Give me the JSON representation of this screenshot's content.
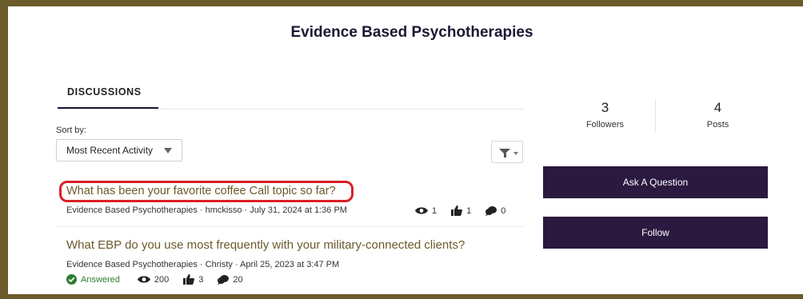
{
  "page": {
    "title": "Evidence Based Psychotherapies"
  },
  "tabs": [
    {
      "label": "DISCUSSIONS",
      "active": true
    }
  ],
  "sort": {
    "label": "Sort by:",
    "selected": "Most Recent Activity"
  },
  "discussions": [
    {
      "title": "What has been your favorite coffee Call topic so far?",
      "meta": "Evidence Based Psychotherapies · hmckisso · July 31, 2024 at 1:36 PM",
      "views": "1",
      "likes": "1",
      "replies": "0",
      "highlighted": true
    },
    {
      "title": "What EBP do you use most frequently with your military-connected clients?",
      "meta": "Evidence Based Psychotherapies · Christy · April 25, 2023 at 3:47 PM",
      "status": "Answered",
      "views": "200",
      "likes": "3",
      "replies": "20"
    }
  ],
  "sidebar": {
    "followers": {
      "count": "3",
      "label": "Followers"
    },
    "posts": {
      "count": "4",
      "label": "Posts"
    },
    "ask_button": "Ask A Question",
    "follow_button": "Follow"
  },
  "colors": {
    "frame": "#6b5a2a",
    "button_bg": "#2b1940",
    "title_link": "#6b5a2a",
    "highlight": "#d91f26",
    "answered": "#2e7d32"
  },
  "icons": [
    "eye-icon",
    "thumbs-up-icon",
    "replies-icon",
    "check-circle-icon",
    "filter-icon",
    "caret-down-icon"
  ]
}
